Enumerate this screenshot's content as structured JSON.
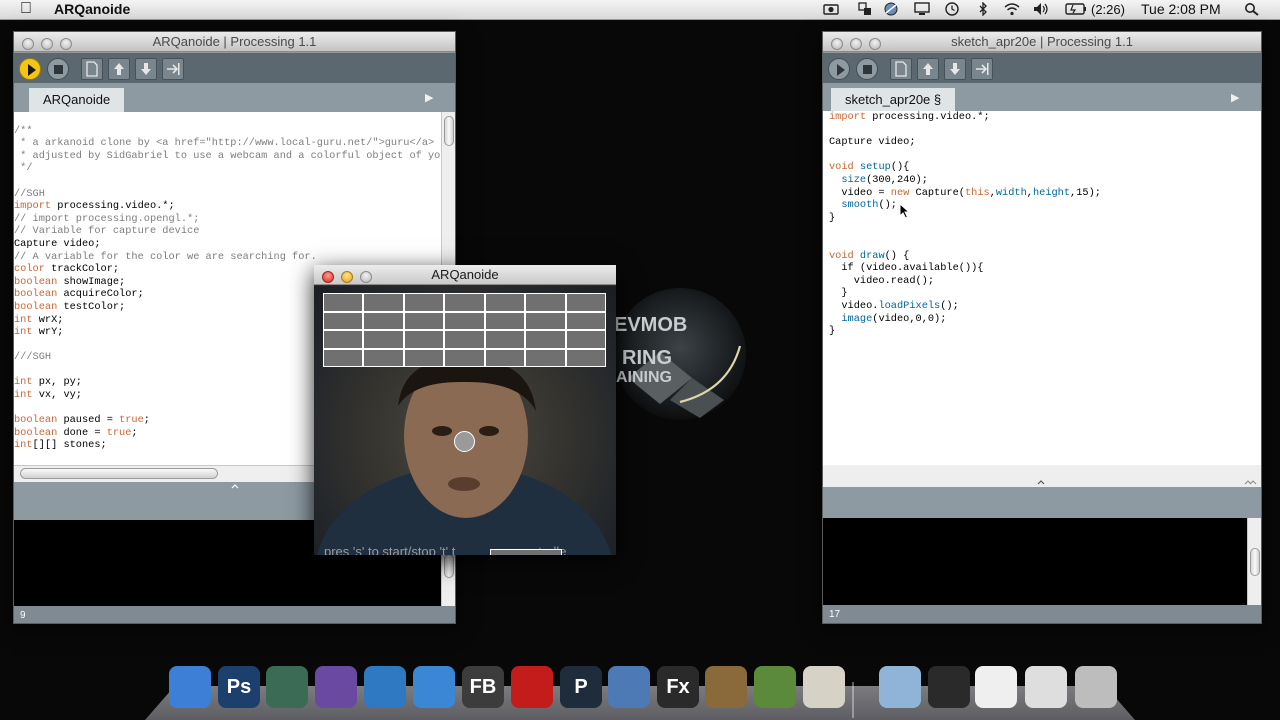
{
  "menubar": {
    "app_name": "ARQanoide",
    "battery_pct": "(2:26)",
    "clock": "Tue 2:08 PM",
    "status_icons": [
      "camera-icon",
      "sync-icon",
      "network-icon",
      "display-icon",
      "time-machine-icon",
      "bluetooth-icon",
      "wifi-icon",
      "volume-icon",
      "battery-icon",
      "spotlight-icon"
    ]
  },
  "left_window": {
    "title": "ARQanoide | Processing 1.1",
    "tab": "ARQanoide",
    "status_line_number": "9",
    "code": [
      "",
      "/**",
      " * a arkanoid clone by <a href=\"http://www.local-guru.net/\">guru</a>",
      " * adjusted by SidGabriel to use a webcam and a colorful object of your",
      " */",
      "",
      "//SGH",
      "import processing.video.*;",
      "// import processing.opengl.*;",
      "// Variable for capture device",
      "Capture video;",
      "// A variable for the color we are searching for.",
      "color trackColor;",
      "boolean showImage;",
      "boolean acquireColor;",
      "boolean testColor;",
      "int wrX;",
      "int wrY;",
      "",
      "///SGH",
      "",
      "int px, py;",
      "int vx, vy;",
      "",
      "boolean paused = true;",
      "boolean done = true;",
      "int[][] stones;"
    ]
  },
  "right_window": {
    "title": "sketch_apr20e | Processing 1.1",
    "tab": "sketch_apr20e §",
    "status_line_number": "17",
    "code": [
      "import processing.video.*;",
      "",
      "Capture video;",
      "",
      "void setup(){",
      "  size(300,240);",
      "  video = new Capture(this,width,height,15);",
      "  smooth();",
      "}",
      "",
      "",
      "void draw() {",
      "  if (video.available()){",
      "    video.read();",
      "  }",
      "  video.loadPixels();",
      "  image(video,0,0);",
      "}"
    ]
  },
  "sketch_window": {
    "title": "ARQanoide",
    "hint_text": "pres 's' to start/stop 't' t",
    "hint_text_tail": "controlle",
    "brick_rows": 4,
    "brick_cols": 7
  },
  "desktop_logo": {
    "line1": "EVMOB",
    "line2": "RING",
    "line3": "AINING"
  },
  "dock": {
    "items": [
      {
        "name": "finder-icon",
        "label": "",
        "color": "#3d7fd6"
      },
      {
        "name": "photoshop-icon",
        "label": "Ps",
        "color": "#1d3f6e"
      },
      {
        "name": "illustrator-brain-icon",
        "label": "",
        "color": "#3b6b55"
      },
      {
        "name": "aperture-gear-icon",
        "label": "",
        "color": "#6a4aa0"
      },
      {
        "name": "globe-icon",
        "label": "",
        "color": "#2f78c2"
      },
      {
        "name": "safari-icon",
        "label": "",
        "color": "#3c86d6"
      },
      {
        "name": "flash-builder-icon",
        "label": "FB",
        "color": "#3c3c3c"
      },
      {
        "name": "flash-icon",
        "label": "",
        "color": "#c41b1b"
      },
      {
        "name": "processing-icon",
        "label": "P",
        "color": "#1e2c3c"
      },
      {
        "name": "virtualbox-icon",
        "label": "",
        "color": "#4d7ab5"
      },
      {
        "name": "flex-icon",
        "label": "Fx",
        "color": "#2a2a2a"
      },
      {
        "name": "media-icon",
        "label": "",
        "color": "#8a6a3a"
      },
      {
        "name": "preview-icon",
        "label": "",
        "color": "#5a8a3a"
      },
      {
        "name": "coffee-cup-icon",
        "label": "",
        "color": "#d6d2c6"
      },
      {
        "name": "folder-icon",
        "label": "",
        "color": "#8fb4d8"
      },
      {
        "name": "window-thumb-1-icon",
        "label": "",
        "color": "#2a2a2a"
      },
      {
        "name": "window-thumb-2-icon",
        "label": "",
        "color": "#efefef"
      },
      {
        "name": "window-thumb-3-icon",
        "label": "",
        "color": "#dedede"
      },
      {
        "name": "trash-icon",
        "label": "",
        "color": "#bdbdbd"
      }
    ]
  }
}
